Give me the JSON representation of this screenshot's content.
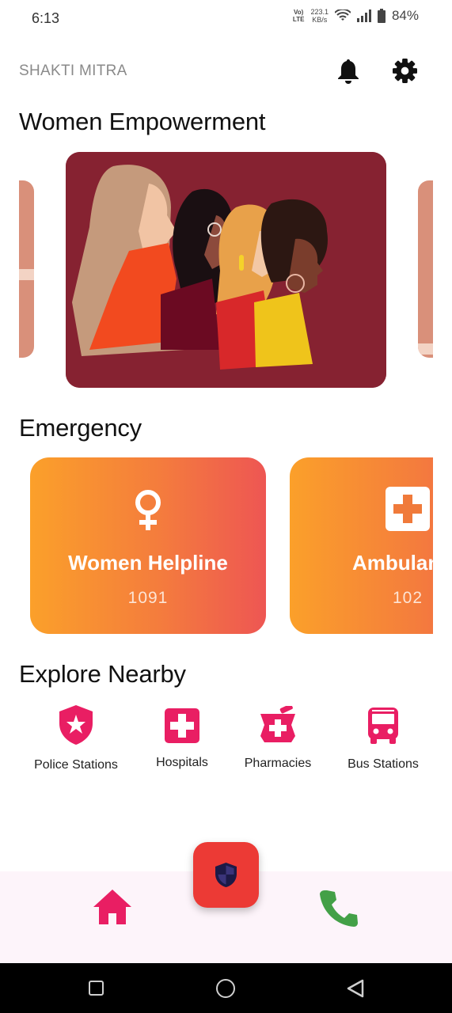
{
  "status_bar": {
    "time": "6:13",
    "volte_line1": "Vo)",
    "volte_line2": "LTE",
    "net_speed_value": "223.1",
    "net_speed_unit": "KB/s",
    "battery": "84%"
  },
  "header": {
    "app_title": "SHAKTI MITRA",
    "notification_icon": "bell-icon",
    "settings_icon": "gear-icon"
  },
  "sections": {
    "women_empowerment": "Women Empowerment",
    "emergency": "Emergency",
    "explore_nearby": "Explore Nearby"
  },
  "emergency_cards": [
    {
      "name": "Women Helpline",
      "number": "1091",
      "icon": "female-symbol-icon"
    },
    {
      "name": "Ambulance",
      "number": "102",
      "icon": "medical-cross-icon"
    }
  ],
  "explore_items": [
    {
      "label": "Police Stations",
      "icon": "police-shield-icon"
    },
    {
      "label": "Hospitals",
      "icon": "hospital-cross-icon"
    },
    {
      "label": "Pharmacies",
      "icon": "pharmacy-mortar-icon"
    },
    {
      "label": "Bus Stations",
      "icon": "bus-icon"
    }
  ],
  "bottom_nav": {
    "home_icon": "home-icon",
    "fab_icon": "security-shield-icon",
    "phone_icon": "phone-icon"
  },
  "colors": {
    "accent_pink": "#e91e63",
    "fab_red": "#ec3a35",
    "phone_green": "#4caf50",
    "card_gradient_start": "#fba02a",
    "card_gradient_end": "#ee5653",
    "banner_bg": "#862231"
  }
}
